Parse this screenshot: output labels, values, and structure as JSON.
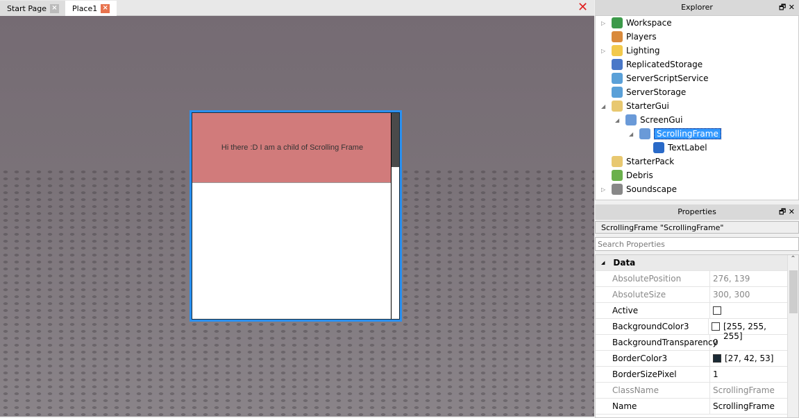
{
  "tabs": [
    {
      "label": "Start Page",
      "close": "×"
    },
    {
      "label": "Place1",
      "close": "×"
    }
  ],
  "close_all": "✕",
  "scrolling_frame": {
    "text_label": "Hi there :D I am a child of Scrolling Frame",
    "canvas_scroll_fraction": 0.25
  },
  "explorer": {
    "title": "Explorer",
    "float_icon": "🗗",
    "close_icon": "✕",
    "items": [
      {
        "label": "Workspace",
        "arrow": "▷",
        "color": "#3c9a4a"
      },
      {
        "label": "Players",
        "arrow": "",
        "color": "#d98a3c"
      },
      {
        "label": "Lighting",
        "arrow": "▷",
        "color": "#f2c94c"
      },
      {
        "label": "ReplicatedStorage",
        "arrow": "",
        "color": "#4a78c8"
      },
      {
        "label": "ServerScriptService",
        "arrow": "",
        "color": "#5aa0d8"
      },
      {
        "label": "ServerStorage",
        "arrow": "",
        "color": "#5aa0d8"
      },
      {
        "label": "StarterGui",
        "arrow": "◢",
        "color": "#e8c870"
      },
      {
        "label": "ScreenGui",
        "arrow": "◢",
        "color": "#6a9ad8"
      },
      {
        "label": "ScrollingFrame",
        "arrow": "◢",
        "color": "#6a9ad8"
      },
      {
        "label": "TextLabel",
        "arrow": "",
        "color": "#2a6ac8"
      },
      {
        "label": "StarterPack",
        "arrow": "",
        "color": "#e8c870"
      },
      {
        "label": "Debris",
        "arrow": "",
        "color": "#6ab04c"
      },
      {
        "label": "Soundscape",
        "arrow": "▷",
        "color": "#888888"
      }
    ]
  },
  "properties": {
    "title": "Properties",
    "float_icon": "🗗",
    "close_icon": "✕",
    "selected": "ScrollingFrame \"ScrollingFrame\"",
    "search_placeholder": "Search Properties",
    "category": "Data",
    "category_arrow": "◢",
    "rows": [
      {
        "name": "AbsolutePosition",
        "value": "276, 139",
        "readonly": true
      },
      {
        "name": "AbsoluteSize",
        "value": "300, 300",
        "readonly": true
      },
      {
        "name": "Active",
        "value": "",
        "checkbox": true
      },
      {
        "name": "BackgroundColor3",
        "value": "[255, 255, 255]",
        "swatch": "#ffffff"
      },
      {
        "name": "BackgroundTransparency",
        "value": "0"
      },
      {
        "name": "BorderColor3",
        "value": "[27, 42, 53]",
        "swatch": "#1b2a35"
      },
      {
        "name": "BorderSizePixel",
        "value": "1"
      },
      {
        "name": "ClassName",
        "value": "ScrollingFrame",
        "readonly": true
      },
      {
        "name": "Name",
        "value": "ScrollingFrame"
      }
    ],
    "scroll_up": "⌃"
  }
}
